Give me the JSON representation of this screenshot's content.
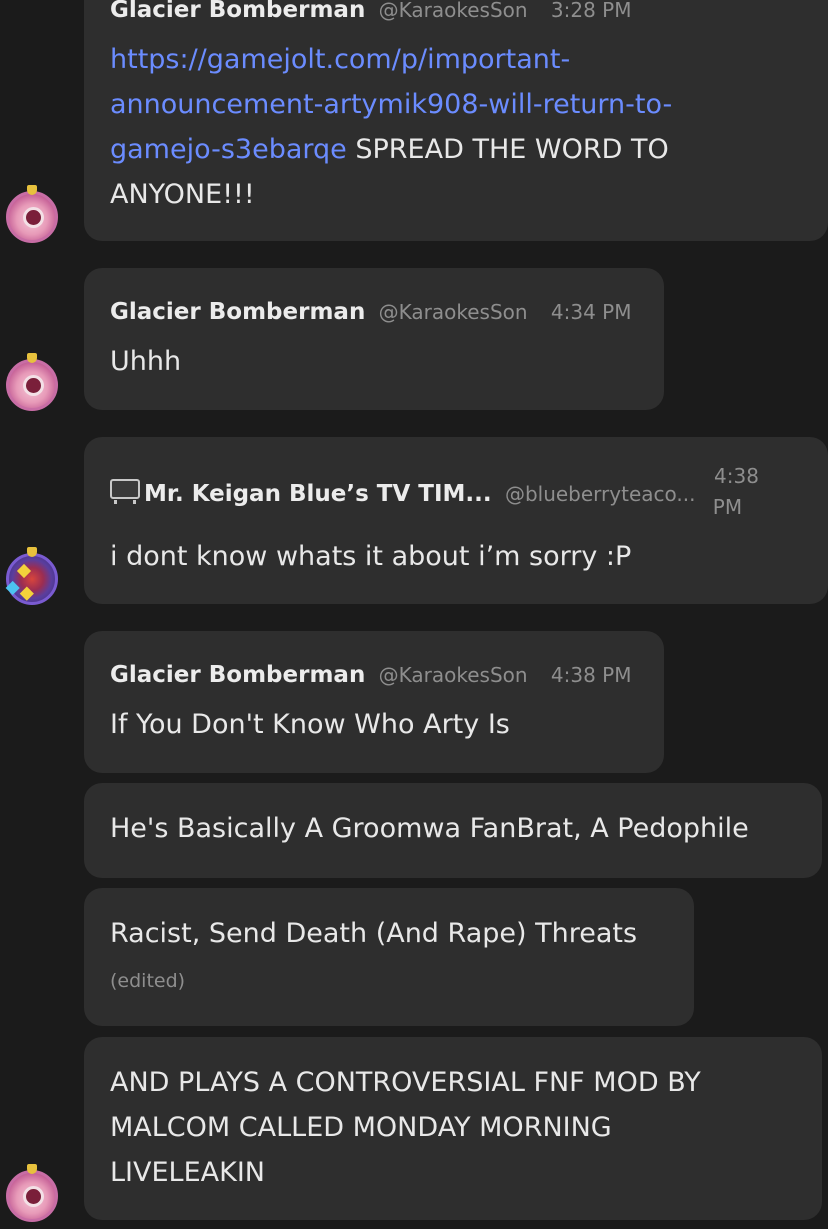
{
  "messages": [
    {
      "name": "Glacier Bomberman",
      "handle": "@KaraokesSon",
      "time": "3:28 PM",
      "link_lines": [
        "https://gamejolt.com/p/important-",
        "announcement-artymik908-will-return-to-",
        "gamejo-s3ebarqe"
      ],
      "text_after_link": " SPREAD THE WORD TO",
      "text_line4": "ANYONE!!!"
    },
    {
      "name": "Glacier Bomberman",
      "handle": "@KaraokesSon",
      "time": "4:34 PM",
      "text": "Uhhh"
    },
    {
      "name": "Mr. Keigan Blue’s TV TIM...",
      "handle": "@blueberryteaco...",
      "time_hour": "4:38",
      "time_ampm": "PM",
      "text": "i dont know whats it about i’m sorry :P"
    },
    {
      "name": "Glacier Bomberman",
      "handle": "@KaraokesSon",
      "time": "4:38 PM",
      "text": "If You Don't Know Who Arty Is"
    },
    {
      "text": "He's Basically A Groomwa FanBrat, A Pedophile"
    },
    {
      "text": "Racist, Send Death (And Rape) Threats",
      "edited": "(edited)"
    },
    {
      "lines": [
        "AND PLAYS A CONTROVERSIAL FNF MOD BY",
        "MALCOM CALLED MONDAY MORNING",
        "LIVELEAKIN"
      ]
    }
  ],
  "colors": {
    "background": "#1b1b1b",
    "bubble": "#2e2e2e",
    "link": "#6b8cff",
    "muted": "#8e8e8e"
  }
}
